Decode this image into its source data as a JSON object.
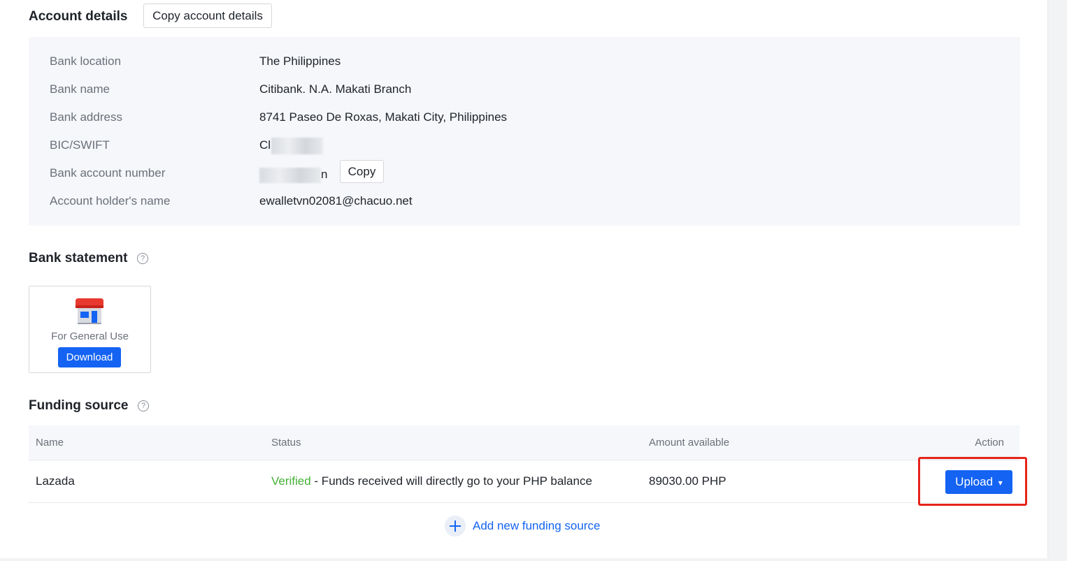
{
  "account_details": {
    "title": "Account details",
    "copy_button": "Copy account details",
    "rows": [
      {
        "label": "Bank location",
        "value": "The Philippines"
      },
      {
        "label": "Bank name",
        "value": "Citibank. N.A. Makati Branch"
      },
      {
        "label": "Bank address",
        "value": "8741 Paseo De Roxas, Makati City, Philippines"
      },
      {
        "label": "BIC/SWIFT",
        "value_visible": "Cl"
      },
      {
        "label": "Bank account number",
        "value_visible": "n"
      },
      {
        "label": "Account holder's name",
        "value": "ewalletvn02081@chacuo.net"
      }
    ],
    "copy_small": "Copy"
  },
  "bank_statement": {
    "title": "Bank statement",
    "help_icon": "question-circle-icon",
    "card_label": "For General Use",
    "card_icon": "store-icon",
    "download_button": "Download"
  },
  "funding_source": {
    "title": "Funding source",
    "help_icon": "question-circle-icon",
    "columns": {
      "name": "Name",
      "status": "Status",
      "amount": "Amount available",
      "action": "Action"
    },
    "row": {
      "name": "Lazada",
      "status": "Verified",
      "status_suffix": " - Funds received will directly go to your PHP balance",
      "amount": "89030.00 PHP",
      "action_button": "Upload",
      "action_caret": "▾"
    },
    "add_link": "Add new funding source",
    "add_icon": "plus-circle-icon"
  },
  "colors": {
    "primary": "#1463f3",
    "success": "#45b035",
    "highlight": "#e6241a",
    "panel_bg": "#f5f7fa"
  }
}
